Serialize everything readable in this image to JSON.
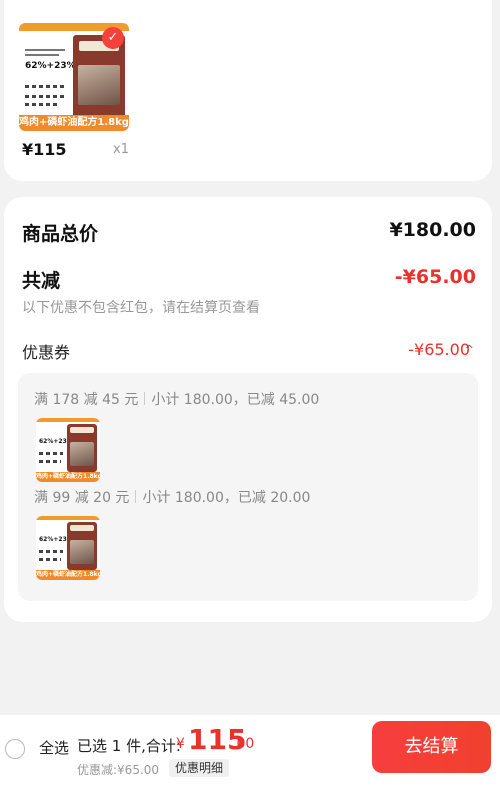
{
  "product": {
    "thumb_headline": "62%+23%",
    "thumb_strip": "鸡肉+磷虾油配方1.8kg",
    "price": "¥115",
    "qty": "x1"
  },
  "summary": {
    "goods_total_label": "商品总价",
    "goods_total_value": "¥180.00",
    "discount_label": "共减",
    "discount_value": "-¥65.00",
    "note": "以下优惠不包含红包，请在结算页查看",
    "coupon_label": "优惠券",
    "coupon_value": "-¥65.00",
    "caret": "^",
    "rules": [
      {
        "condition": "满 178 减 45 元",
        "detail": "小计 180.00，已减 45.00"
      },
      {
        "condition": "满 99 减 20 元",
        "detail": "小计 180.00，已减 20.00"
      }
    ]
  },
  "bottom_bar": {
    "select_all": "全选",
    "selected_prefix": "已选 1 件,合计:",
    "currency": "¥",
    "total_int": "115",
    "total_dec": ".00",
    "saved": "优惠减:¥65.00",
    "detail_button": "优惠明细",
    "checkout_button": "去结算"
  },
  "colors": {
    "accent": "#e8322c",
    "strip": "#f08a2a",
    "background": "#f2f2f2"
  },
  "icons": {
    "check": "check-icon",
    "radio": "radio-unchecked-icon",
    "caret": "chevron-up-icon"
  }
}
